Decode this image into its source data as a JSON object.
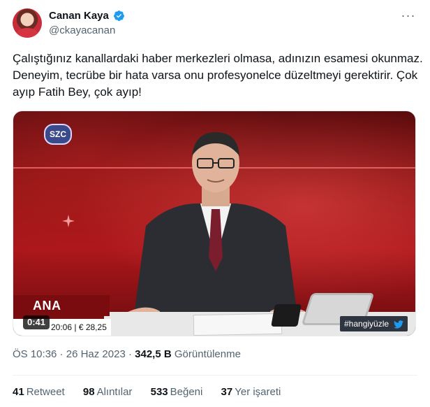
{
  "author": {
    "name": "Canan Kaya",
    "handle": "@ckayacanan"
  },
  "tweet": {
    "text": "Çalıştığınız kanallardaki haber merkezleri olmasa, adınızın esamesi okunmaz. Deneyim, tecrübe bir hata varsa onu profesyonelce düzeltmeyi gerektirir. Çok ayıp Fatih Bey, çok ayıp!"
  },
  "media": {
    "duration": "0:41",
    "channel_logo": "SZC",
    "banner": "ANA HABER",
    "ticker_time": "20:06",
    "ticker_value": "€ 28,25",
    "ticker_arrow": "▲",
    "hashtag": "#hangiyüzle"
  },
  "meta": {
    "time": "ÖS 10:36",
    "sep": " · ",
    "date": "26 Haz 2023",
    "sep2": " · ",
    "views_count": "342,5 B",
    "views_label": "Görüntülenme"
  },
  "stats": [
    {
      "count": "41",
      "label": "Retweet"
    },
    {
      "count": "98",
      "label": "Alıntılar"
    },
    {
      "count": "533",
      "label": "Beğeni"
    },
    {
      "count": "37",
      "label": "Yer işareti"
    }
  ],
  "colors": {
    "verified": "#1d9bf0",
    "secondary_text": "#536471",
    "primary_text": "#0f1419"
  },
  "icons": {
    "verified": "verified-badge-icon",
    "more": "more-options-icon",
    "bird": "twitter-bird-icon"
  }
}
